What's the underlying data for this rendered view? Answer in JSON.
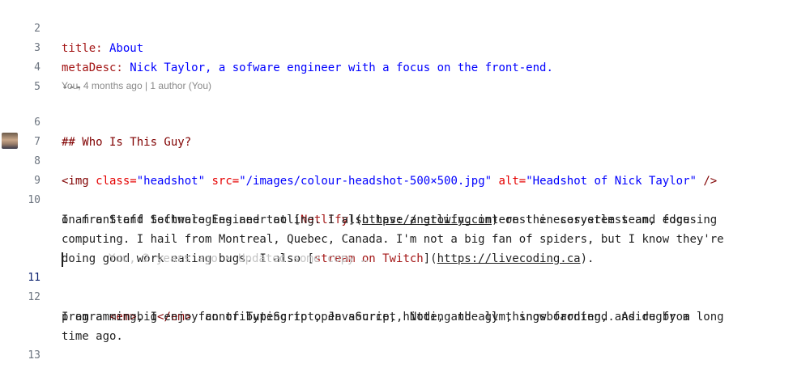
{
  "lines": {
    "l2": {
      "num": "2",
      "key": "title:",
      "value": " About"
    },
    "l3": {
      "num": "3",
      "key": "metaDesc:",
      "value": " Nick Taylor, a sofware engineer with a focus on the front-end."
    },
    "l4": {
      "num": "4",
      "text": "---"
    },
    "l5": {
      "num": "5"
    },
    "blame_header": "You, 4 months ago | 1 author (You)",
    "l6": {
      "num": "6",
      "text": "## Who Is This Guy?"
    },
    "l7": {
      "num": "7"
    },
    "l8": {
      "num": "8",
      "tag_open": "<img",
      "attr1": " class=",
      "val1": "\"headshot\"",
      "attr2": " src=",
      "val2": "\"/images/colour-headshot-500×500.jpg\"",
      "attr3": " alt=",
      "val3": "\"Headshot of Nick Taylor\"",
      "tag_close": " />"
    },
    "l9": {
      "num": "9"
    },
    "l10": {
      "num": "10",
      "r1_a": "I am a Staff Software Engineer at [",
      "r1_link": "Netlify",
      "r1_b": "](",
      "r1_url": "https://netlify.com",
      "r1_c": ") on the ecosystem team, focusing",
      "r2": "on front-end technologies and tooling. I also have a growing interest in serverless and edge",
      "r3": "computing. I hail from Montreal, Quebec, Canada. I'm not a big fan of spiders, but I know they're",
      "r4_a": "doing good work eating bugs. I also [",
      "r4_link": "stream on Twitch",
      "r4_b": "](",
      "r4_url": "https://livecoding.ca",
      "r4_c": ")."
    },
    "l11": {
      "num": "11",
      "ghost": "You, 2 years ago • Updated some copy …"
    },
    "l12": {
      "num": "12",
      "r1_a": "I am a ",
      "r1_tag1": "<em>",
      "r1_b": "big",
      "r1_tag2": "</em>",
      "r1_c": " fan of TypeScript, JavaScript, Node, and all things frontend. Aside from",
      "r2": "programming, I enjoy contributing to open source, hitting the gym, snowboarding, and rugby a long",
      "r3": "time ago."
    },
    "l13": {
      "num": "13"
    }
  },
  "icons": {
    "avatar": "author-avatar-icon"
  },
  "colors": {
    "key": "#a31515",
    "string": "#0000ff",
    "heading": "#800000",
    "attribute": "#e50000"
  }
}
